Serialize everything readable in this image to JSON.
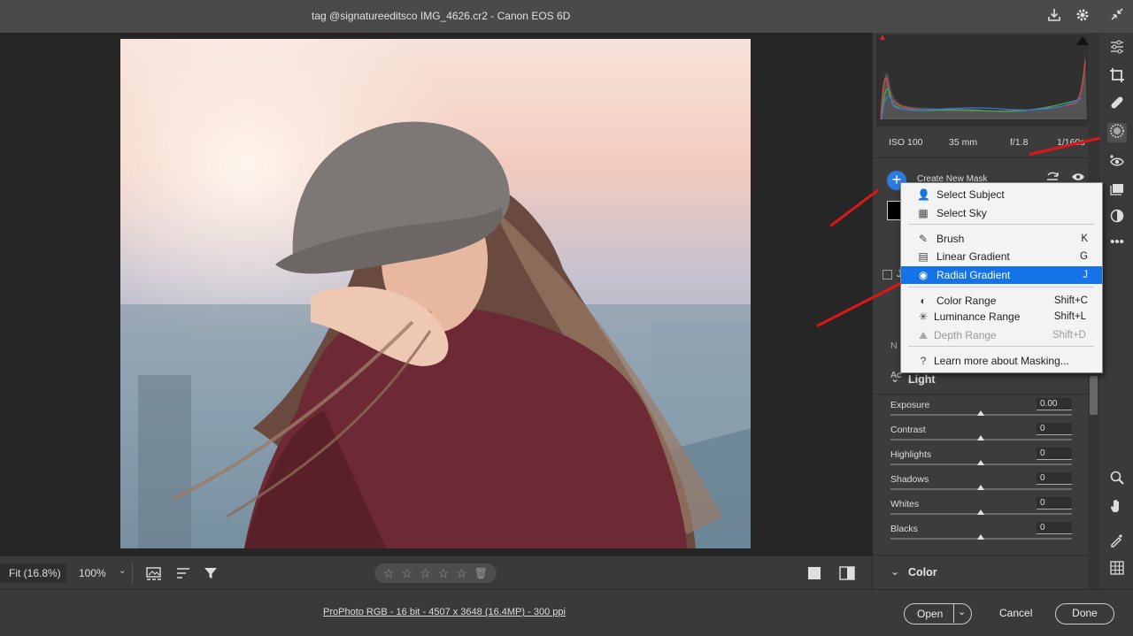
{
  "titlebar": {
    "title": "tag @signatureeditsco IMG_4626.cr2  -  Canon EOS 6D"
  },
  "histogram": {
    "exif": {
      "iso": "ISO 100",
      "focal": "35 mm",
      "aperture": "f/1.8",
      "shutter": "1/160s"
    }
  },
  "masking": {
    "create_label": "Create New Mask",
    "partial_1": "J",
    "partial_2": "N",
    "partial_3": "Ac"
  },
  "menu": {
    "items": [
      {
        "label": "Select Subject",
        "key": ""
      },
      {
        "label": "Select Sky",
        "key": ""
      },
      {
        "label": "Brush",
        "key": "K"
      },
      {
        "label": "Linear Gradient",
        "key": "G"
      },
      {
        "label": "Radial Gradient",
        "key": "J"
      },
      {
        "label": "Color Range",
        "key": "Shift+C"
      },
      {
        "label": "Luminance Range",
        "key": "Shift+L"
      },
      {
        "label": "Depth Range",
        "key": "Shift+D"
      },
      {
        "label": "Learn more about Masking...",
        "key": ""
      }
    ],
    "highlighted_index": 4
  },
  "light": {
    "title": "Light",
    "sliders": [
      {
        "label": "Exposure",
        "value": "0.00",
        "position": 0.5
      },
      {
        "label": "Contrast",
        "value": "0",
        "position": 0.5
      },
      {
        "label": "Highlights",
        "value": "0",
        "position": 0.5
      },
      {
        "label": "Shadows",
        "value": "0",
        "position": 0.5
      },
      {
        "label": "Whites",
        "value": "0",
        "position": 0.5
      },
      {
        "label": "Blacks",
        "value": "0",
        "position": 0.5
      }
    ]
  },
  "color_section": {
    "title": "Color"
  },
  "bottombar": {
    "fit": "Fit (16.8%)",
    "zoom": "100%",
    "rating_max": 5
  },
  "footer": {
    "info": "ProPhoto RGB - 16 bit - 4507 x 3648 (16.4MP) - 300 ppi",
    "open": "Open",
    "cancel": "Cancel",
    "done": "Done"
  },
  "colors": {
    "accent": "#1473e6",
    "plus_button": "#2b7be0",
    "annotation_arrow": "#e01616"
  }
}
